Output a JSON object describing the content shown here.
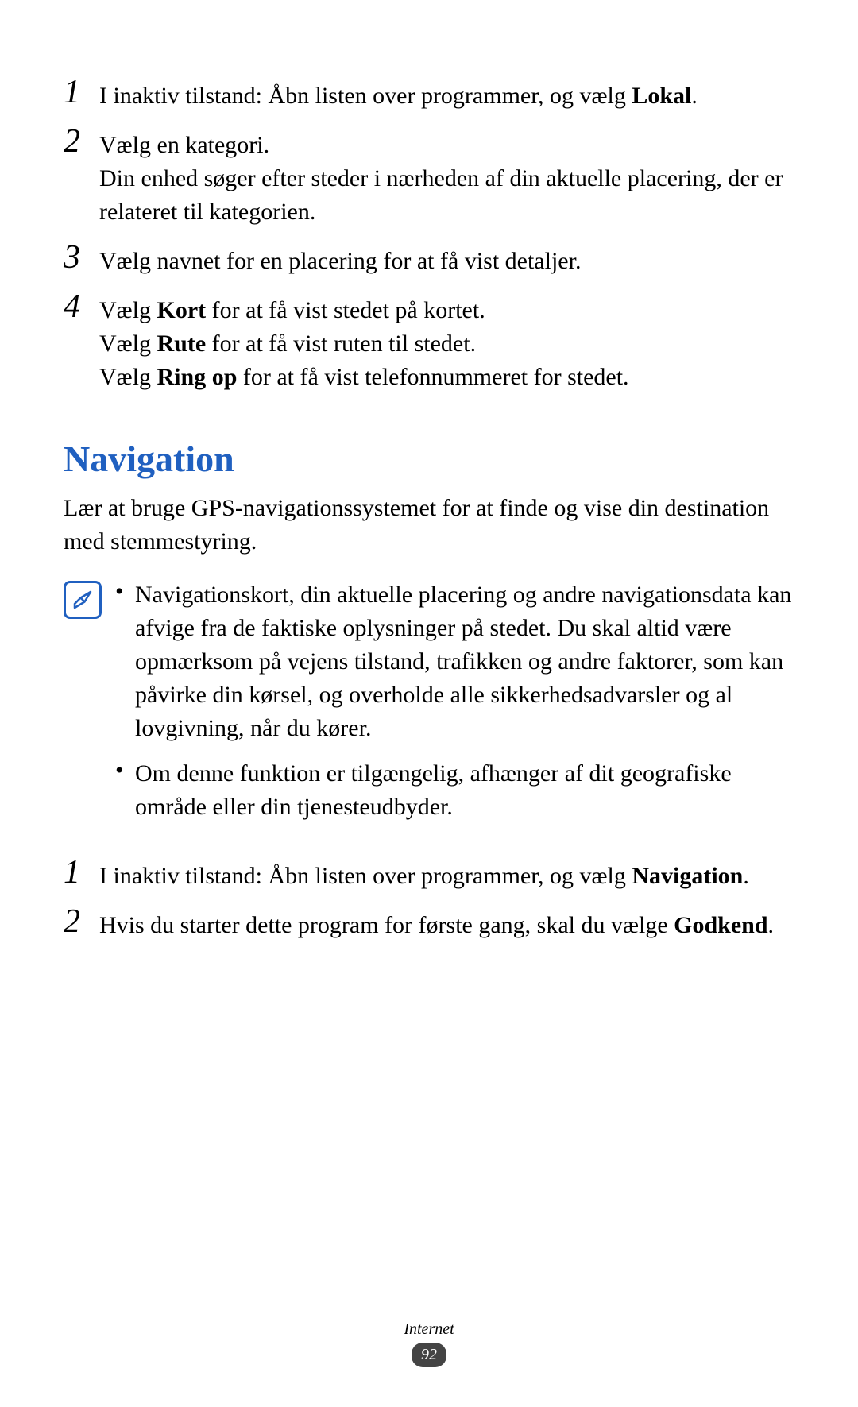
{
  "steps_a": {
    "1": {
      "number": "1",
      "text_prefix": "I inaktiv tilstand: Åbn listen over programmer, og vælg ",
      "bold": "Lokal",
      "text_suffix": "."
    },
    "2": {
      "number": "2",
      "line1": "Vælg en kategori.",
      "line2": "Din enhed søger efter steder i nærheden af din aktuelle placering, der er relateret til kategorien."
    },
    "3": {
      "number": "3",
      "text": "Vælg navnet for en placering for at få vist detaljer."
    },
    "4": {
      "number": "4",
      "line1_prefix": "Vælg ",
      "line1_bold": "Kort",
      "line1_suffix": " for at få vist stedet på kortet.",
      "line2_prefix": "Vælg ",
      "line2_bold": "Rute",
      "line2_suffix": " for at få vist ruten til stedet.",
      "line3_prefix": "Vælg ",
      "line3_bold": "Ring op",
      "line3_suffix": " for at få vist telefonnummeret for stedet."
    }
  },
  "heading": "Navigation",
  "intro": "Lær at bruge GPS-navigationssystemet for at finde og vise din destination med stemmestyring.",
  "note": {
    "bullet1": "Navigationskort, din aktuelle placering og andre navigationsdata kan afvige fra de faktiske oplysninger på stedet. Du skal altid være opmærksom på vejens tilstand, trafikken og andre faktorer, som kan påvirke din kørsel, og overholde alle sikkerhedsadvarsler og al lovgivning, når du kører.",
    "bullet2": "Om denne funktion er tilgængelig, afhænger af dit geografiske område eller din tjenesteudbyder."
  },
  "steps_b": {
    "1": {
      "number": "1",
      "text_prefix": "I inaktiv tilstand: Åbn listen over programmer, og vælg ",
      "bold": "Navigation",
      "text_suffix": "."
    },
    "2": {
      "number": "2",
      "text_prefix": "Hvis du starter dette program for første gang, skal du vælge ",
      "bold": "Godkend",
      "text_suffix": "."
    }
  },
  "footer": {
    "category": "Internet",
    "page": "92"
  }
}
